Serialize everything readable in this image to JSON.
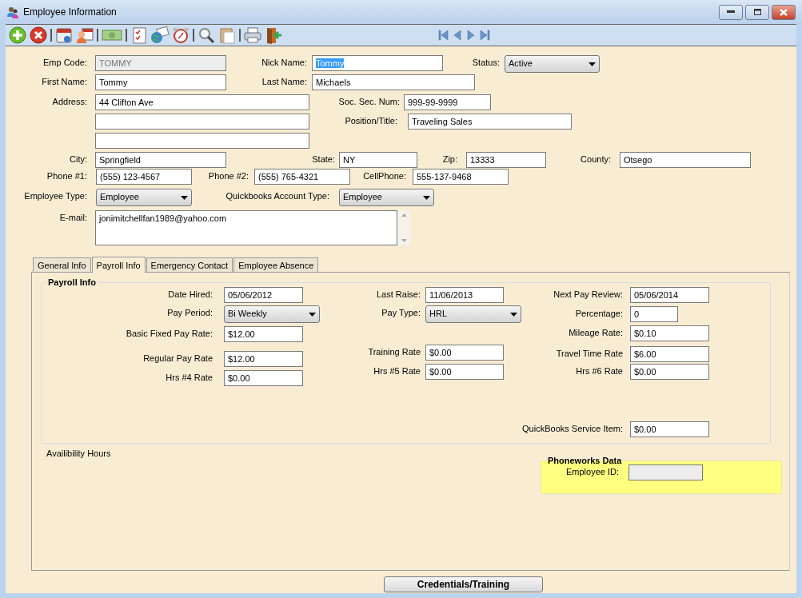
{
  "window": {
    "title": "Employee Information"
  },
  "employee": {
    "rows": [
      [
        {
          "label": "Emp Code:",
          "value": "TOMMY",
          "kind": "readonly"
        },
        {
          "label": "Nick Name:",
          "value": "Tommy",
          "kind": "text",
          "highlighted": true
        },
        {
          "label": "Status:",
          "value": "Active",
          "kind": "select"
        }
      ],
      [
        {
          "label": "First Name:",
          "value": "Tommy",
          "kind": "text"
        },
        {
          "label": "Last Name:",
          "value": "Michaels",
          "kind": "text"
        }
      ],
      [
        {
          "label": "Address:",
          "value": "44 Clifton Ave",
          "kind": "text"
        },
        {
          "label": "Soc. Sec. Num:",
          "value": "999-99-9999",
          "kind": "text"
        }
      ],
      [
        {
          "kind": "text"
        },
        {
          "label": "Position/Title:",
          "value": "Traveling Sales",
          "kind": "text"
        }
      ],
      [
        {
          "kind": "text"
        }
      ],
      [
        {
          "label": "City:",
          "value": "Springfield",
          "kind": "text"
        },
        {
          "label": "State:",
          "value": "NY",
          "kind": "text"
        },
        {
          "label": "Zip:",
          "value": "13333",
          "kind": "text"
        },
        {
          "label": "County:",
          "value": "Otsego",
          "kind": "text"
        }
      ],
      [
        {
          "label": "Phone #1:",
          "value": "(555) 123-4567",
          "kind": "text"
        },
        {
          "label": "Phone #2:",
          "value": "(555) 765-4321",
          "kind": "text"
        },
        {
          "label": "CellPhone:",
          "value": "555-137-9468",
          "kind": "text"
        }
      ],
      [
        {
          "label": "Employee Type:",
          "value": "Employee",
          "kind": "select"
        },
        {
          "label": "Quickbooks Account Type:",
          "value": "Employee",
          "kind": "select"
        }
      ],
      [
        {
          "label": "E-mail:",
          "value": "jonimitchellfan1989@yahoo.com",
          "kind": "memo"
        }
      ]
    ]
  },
  "tabs": [
    {
      "label": "General Info",
      "selected": false
    },
    {
      "label": "Payroll Info",
      "selected": true
    },
    {
      "label": "Emergency Contact",
      "selected": false
    },
    {
      "label": "Employee Absence",
      "selected": false
    }
  ],
  "payroll": {
    "title": "Payroll Info",
    "columns": [
      [
        {
          "label": "Date Hired:",
          "value": "05/06/2012",
          "kind": "text"
        },
        {
          "label": "Pay Period:",
          "value": "Bi Weekly",
          "kind": "select"
        },
        {
          "label": "Basic Fixed Pay Rate:",
          "value": "$12.00",
          "kind": "text"
        },
        {
          "label": "Regular Pay Rate",
          "value": "$12.00",
          "kind": "text"
        },
        {
          "label": "Hrs #4 Rate",
          "value": "$0.00",
          "kind": "text"
        }
      ],
      [
        {
          "label": "Last Raise:",
          "value": "11/06/2013",
          "kind": "text"
        },
        {
          "label": "Pay Type:",
          "value": "HRL",
          "kind": "select"
        },
        {
          "label": "Training Rate",
          "value": "$0.00",
          "kind": "text"
        },
        {
          "label": "Hrs #5 Rate",
          "value": "$0.00",
          "kind": "text"
        }
      ],
      [
        {
          "label": "Next Pay Review:",
          "value": "05/06/2014",
          "kind": "text"
        },
        {
          "label": "Percentage:",
          "value": "0",
          "kind": "text"
        },
        {
          "label": "Mileage Rate:",
          "value": "$0.10",
          "kind": "text"
        },
        {
          "label": "Travel Time Rate",
          "value": "$6.00",
          "kind": "text"
        },
        {
          "label": "Hrs #6 Rate",
          "value": "$0.00",
          "kind": "text"
        },
        {
          "label": "QuickBooks Service Item:",
          "value": "$0.00",
          "kind": "text"
        }
      ]
    ]
  },
  "availability": {
    "label": "Availibility Hours"
  },
  "phoneworks": {
    "title": "Phoneworks Data",
    "field": {
      "label": "Employee ID:",
      "kind": "readonly"
    }
  },
  "buttons": [
    "Credentials/Training"
  ]
}
